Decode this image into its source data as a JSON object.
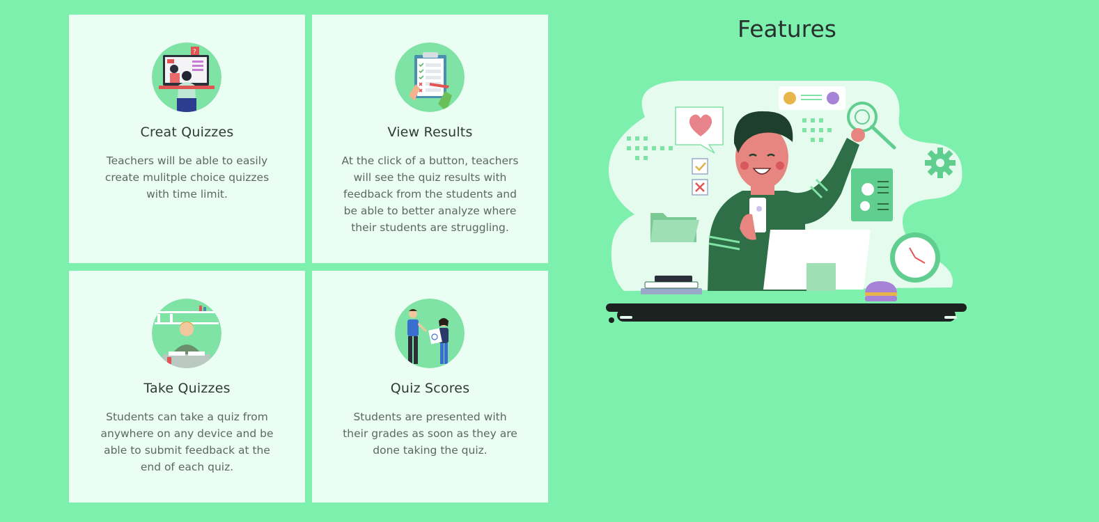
{
  "section": {
    "title": "Features"
  },
  "features": [
    {
      "title": "Creat Quizzes",
      "text": "Teachers will be able to easily create mulitple choice quizzes with time limit.",
      "icon": "teacher-computer-icon"
    },
    {
      "title": "View Results",
      "text": "At the click of a button, teachers will see the quiz results with feedback from the students and be able to better analyze where their students are struggling.",
      "icon": "clipboard-results-icon"
    },
    {
      "title": "Take Quizzes",
      "text": "Students can take a quiz from anywhere on any device and be able to submit feedback at the end of each quiz.",
      "icon": "student-writing-icon"
    },
    {
      "title": "Quiz Scores",
      "text": "Students are presented with their grades as soon as they are done taking the quiz.",
      "icon": "graded-paper-icon"
    }
  ],
  "colors": {
    "background": "#7ef0ad",
    "card": "#ebfef3",
    "accent_dark_green": "#2e6b45",
    "blob": "#e4fbee"
  }
}
